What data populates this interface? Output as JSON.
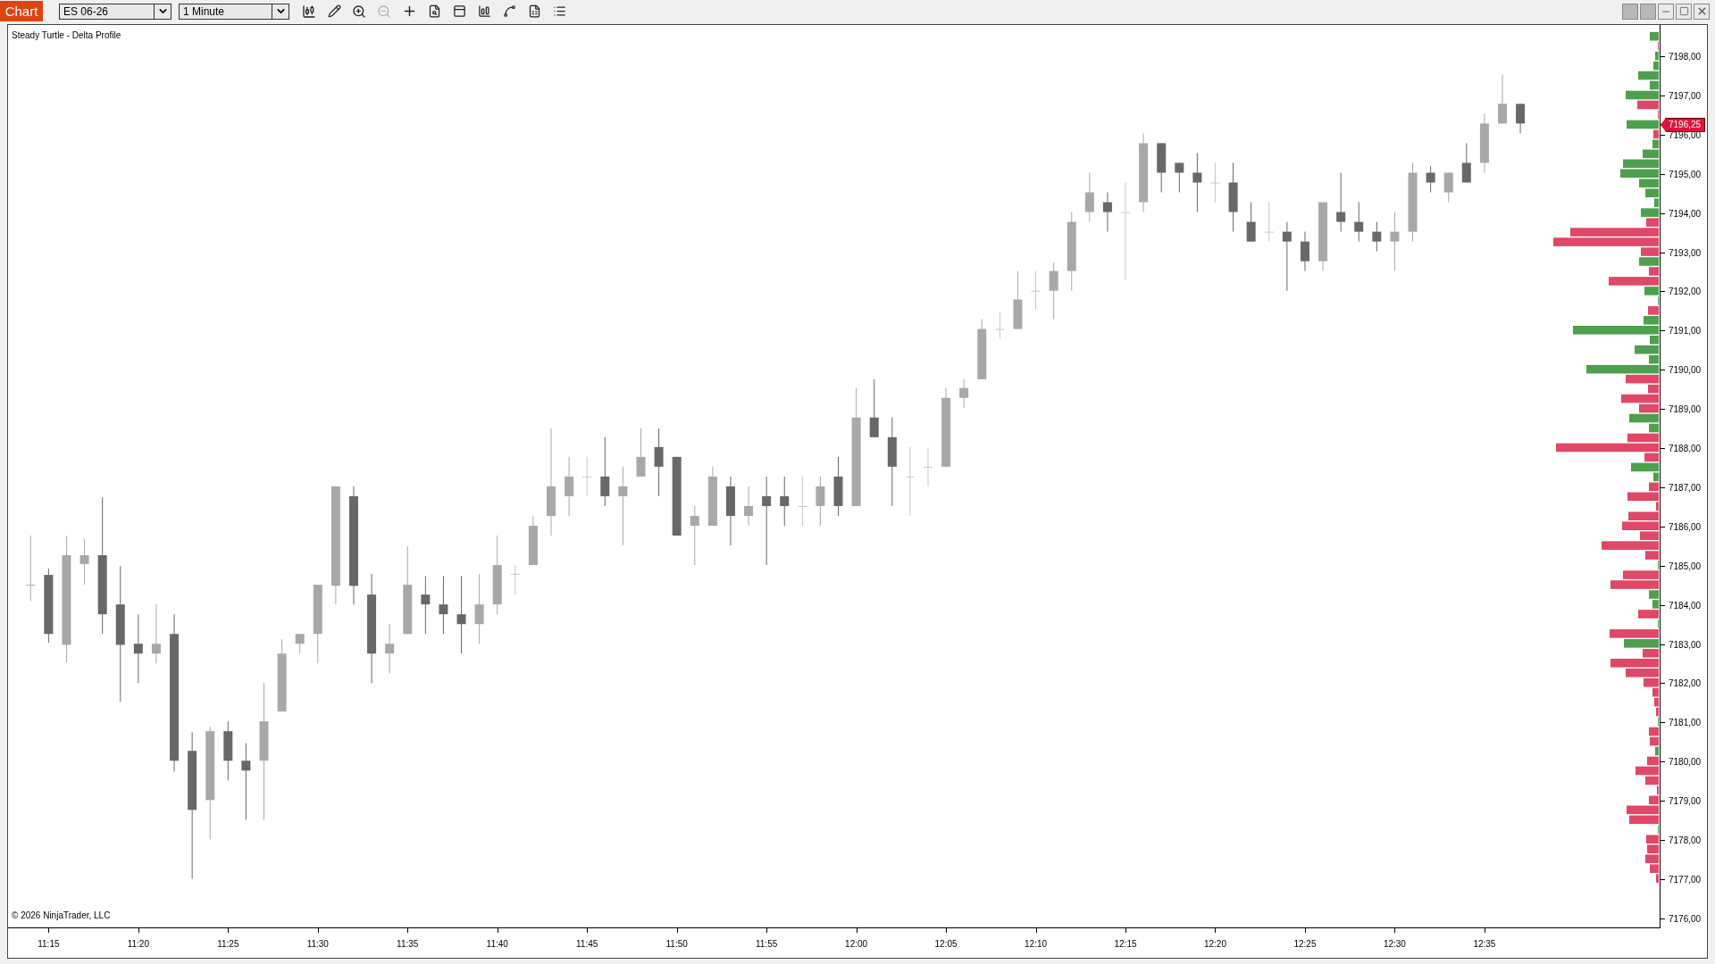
{
  "toolbar": {
    "tab": "Chart",
    "instrument": "ES 06-26",
    "interval": "1 Minute"
  },
  "chart": {
    "title": "Steady Turtle - Delta Profile",
    "copyright": "© 2026 NinjaTrader, LLC",
    "price_labels": [
      "7198,00",
      "7197,00",
      "7196,00",
      "7195,00",
      "7194,00",
      "7193,00",
      "7192,00",
      "7191,00",
      "7190,00",
      "7189,00",
      "7188,00",
      "7187,00",
      "7186,00",
      "7185,00",
      "7184,00",
      "7183,00",
      "7182,00",
      "7181,00",
      "7180,00",
      "7179,00",
      "7178,00",
      "7177,00",
      "7176,00"
    ],
    "current_price": "7196,25",
    "time_labels": [
      "11:15",
      "11:20",
      "11:25",
      "11:30",
      "11:35",
      "11:40",
      "11:45",
      "11:50",
      "11:55",
      "12:00",
      "12:05",
      "12:10",
      "12:15",
      "12:20",
      "12:25",
      "12:30",
      "12:35"
    ]
  }
}
